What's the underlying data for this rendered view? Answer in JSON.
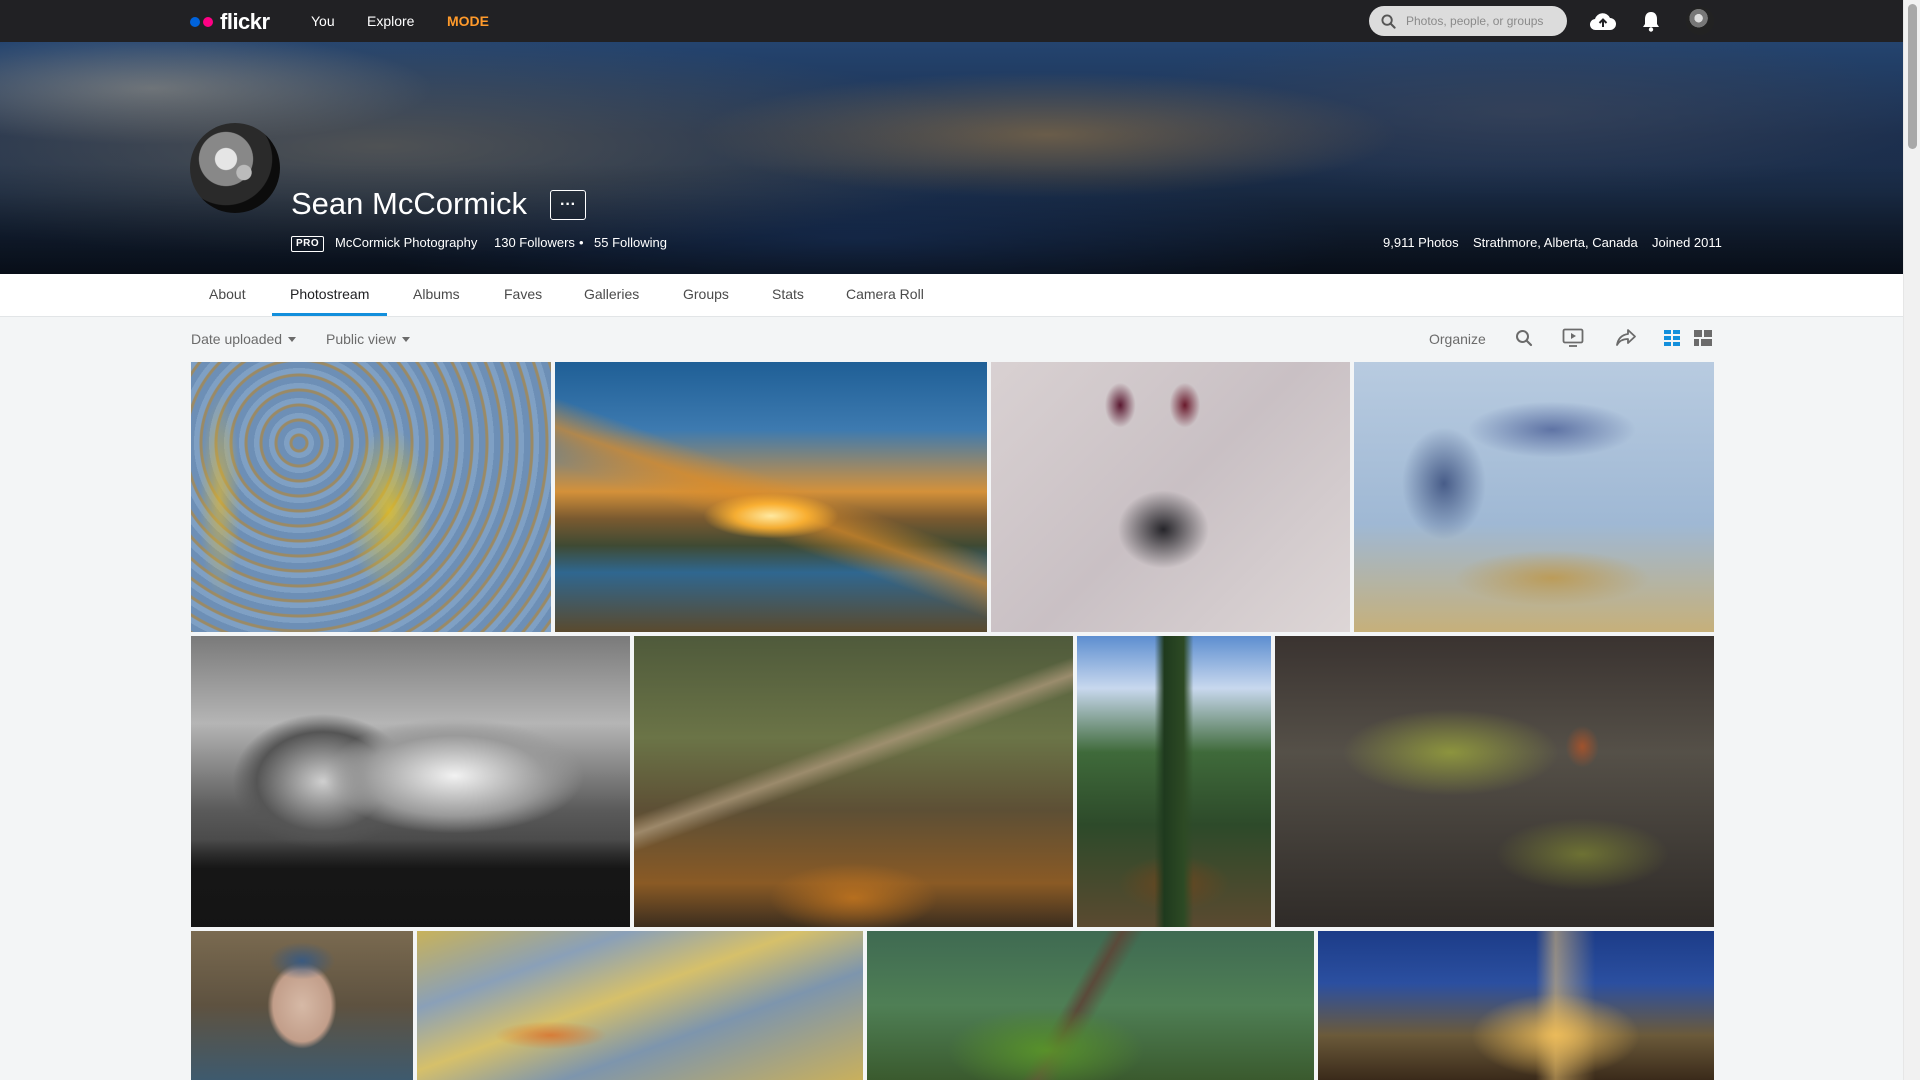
{
  "nav": {
    "logo_text": "flickr",
    "logo_colors": {
      "blue": "#0063dc",
      "pink": "#ff0084"
    },
    "links": {
      "you": "You",
      "explore": "Explore",
      "mode": "MODE"
    },
    "mode_color": "#ff9a2b",
    "search_placeholder": "Photos, people, or groups",
    "icons": [
      "upload-cloud-icon",
      "notifications-bell-icon",
      "account-avatar"
    ]
  },
  "profile": {
    "name": "Sean McCormick",
    "more_label": "···",
    "pro_badge": "PRO",
    "website": "McCormick Photography",
    "followers": "130 Followers",
    "separator": "•",
    "following": "55 Following",
    "photos": "9,911 Photos",
    "location": "Strathmore, Alberta, Canada",
    "joined": "Joined 2011"
  },
  "tabs": [
    {
      "label": "About",
      "active": false
    },
    {
      "label": "Photostream",
      "active": true
    },
    {
      "label": "Albums",
      "active": false
    },
    {
      "label": "Faves",
      "active": false
    },
    {
      "label": "Galleries",
      "active": false
    },
    {
      "label": "Groups",
      "active": false
    },
    {
      "label": "Stats",
      "active": false
    },
    {
      "label": "Camera Roll",
      "active": false
    }
  ],
  "accent_color": "#128fdc",
  "toolbar": {
    "sort_label": "Date uploaded",
    "view_label": "Public view",
    "organize_label": "Organize",
    "icons": [
      "search-icon",
      "slideshow-icon",
      "share-icon",
      "grid-view-icon",
      "justified-view-icon"
    ]
  },
  "photos": [
    {
      "name": "photo-peeling-paint"
    },
    {
      "name": "photo-sunset-river"
    },
    {
      "name": "photo-graffiti-sad-face"
    },
    {
      "name": "photo-graffiti-text"
    },
    {
      "name": "photo-mountain-peaks-bw"
    },
    {
      "name": "photo-fallen-tree-water"
    },
    {
      "name": "photo-forest-stream"
    },
    {
      "name": "photo-pinecone-moss"
    },
    {
      "name": "photo-self-portrait"
    },
    {
      "name": "photo-water-reflection"
    },
    {
      "name": "photo-tree-branches"
    },
    {
      "name": "photo-lodge-night"
    }
  ]
}
